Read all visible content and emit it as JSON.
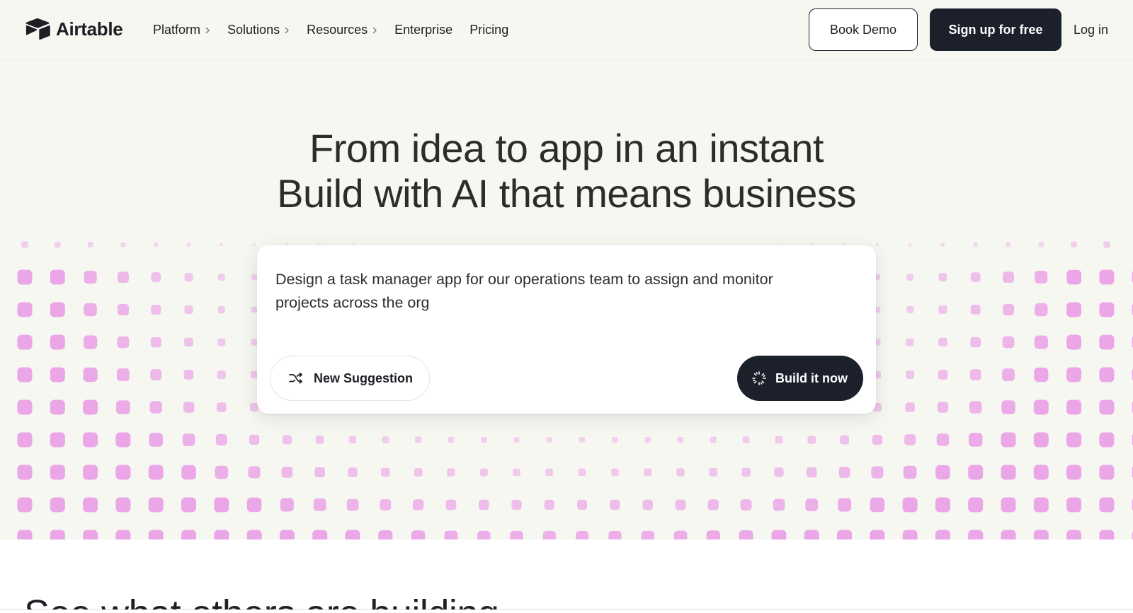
{
  "nav": {
    "logo_text": "Airtable",
    "items": [
      {
        "label": "Platform",
        "has_submenu": true
      },
      {
        "label": "Solutions",
        "has_submenu": true
      },
      {
        "label": "Resources",
        "has_submenu": true
      },
      {
        "label": "Enterprise",
        "has_submenu": false
      },
      {
        "label": "Pricing",
        "has_submenu": false
      }
    ],
    "book_demo_label": "Book Demo",
    "signup_label": "Sign up for free",
    "login_label": "Log in"
  },
  "hero": {
    "headline_line1": "From idea to app in an instant",
    "headline_line2": "Build with AI that means business",
    "prompt_text": "Design a task manager app for our operations team to assign and monitor projects across the org",
    "new_suggestion_label": "New Suggestion",
    "build_label": "Build it now"
  },
  "section": {
    "title": "See what others are building"
  },
  "colors": {
    "accent_dark": "#1b202b",
    "hero_bg": "#f7f7f2",
    "dot_pink": "#e99ce6"
  },
  "icons": [
    "airtable-logo-icon",
    "chevron-right-icon",
    "shuffle-icon",
    "sparkle-spinner-icon"
  ]
}
